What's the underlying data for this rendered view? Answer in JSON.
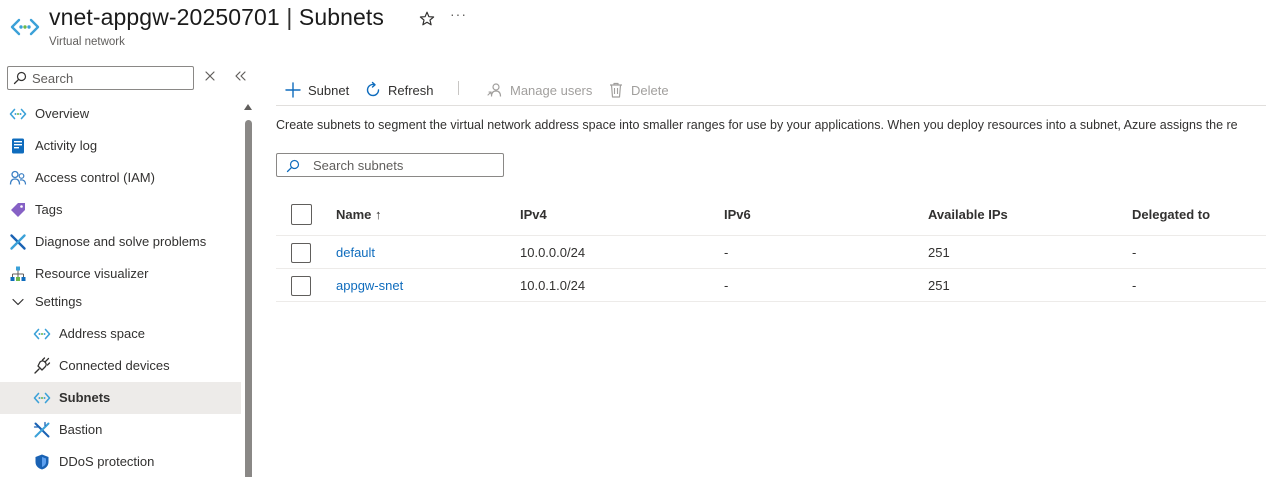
{
  "header": {
    "resource_name": "vnet-appgw-20250701",
    "separator": "|",
    "page_name": "Subnets",
    "resource_type": "Virtual network",
    "more_label": "···"
  },
  "sidebar": {
    "search_placeholder": "Search",
    "items": [
      {
        "label": "Overview",
        "icon": "vnet-icon"
      },
      {
        "label": "Activity log",
        "icon": "activity-log-icon"
      },
      {
        "label": "Access control (IAM)",
        "icon": "people-icon"
      },
      {
        "label": "Tags",
        "icon": "tag-icon"
      },
      {
        "label": "Diagnose and solve problems",
        "icon": "wrench-icon"
      },
      {
        "label": "Resource visualizer",
        "icon": "hierarchy-icon"
      },
      {
        "label": "Settings",
        "icon": "chevron-down-icon"
      },
      {
        "label": "Address space",
        "icon": "vnet-icon"
      },
      {
        "label": "Connected devices",
        "icon": "plug-icon"
      },
      {
        "label": "Subnets",
        "icon": "vnet-icon",
        "selected": true
      },
      {
        "label": "Bastion",
        "icon": "bastion-icon"
      },
      {
        "label": "DDoS protection",
        "icon": "shield-icon"
      }
    ]
  },
  "toolbar": {
    "subnet_label": "Subnet",
    "refresh_label": "Refresh",
    "manage_users_label": "Manage users",
    "delete_label": "Delete"
  },
  "description": "Create subnets to segment the virtual network address space into smaller ranges for use by your applications. When you deploy resources into a subnet, Azure assigns the re",
  "filter": {
    "placeholder": "Search subnets"
  },
  "table": {
    "columns": {
      "name": "Name ↑",
      "ipv4": "IPv4",
      "ipv6": "IPv6",
      "available": "Available IPs",
      "delegated": "Delegated to"
    },
    "rows": [
      {
        "name": "default",
        "ipv4": "10.0.0.0/24",
        "ipv6": "-",
        "available": "251",
        "delegated": "-"
      },
      {
        "name": "appgw-snet",
        "ipv4": "10.0.1.0/24",
        "ipv6": "-",
        "available": "251",
        "delegated": "-"
      }
    ]
  },
  "colors": {
    "accent": "#0f6cbd",
    "vnet_icon": "#3ba1d8",
    "selected_bg": "#edebe9",
    "text": "#323130",
    "muted": "#605e5c",
    "disabled": "#a19f9d"
  }
}
